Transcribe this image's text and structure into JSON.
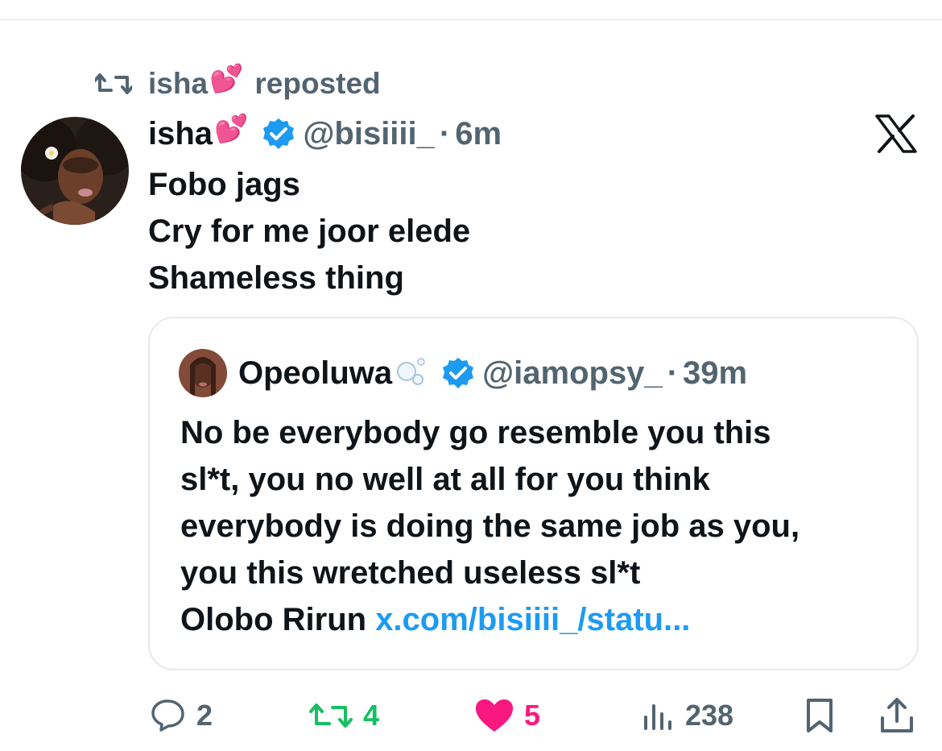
{
  "repost": {
    "name": "isha",
    "label": "reposted"
  },
  "tweet": {
    "author_name": "isha",
    "handle": "@bisiiii_",
    "separator": "·",
    "time": "6m",
    "lines": [
      "Fobo jags",
      "Cry for me joor elede",
      "Shameless thing"
    ]
  },
  "quote": {
    "author_name": "Opeoluwa",
    "handle": "@iamopsy_",
    "separator": "·",
    "time": "39m",
    "lines": [
      "No be everybody go resemble you this",
      "sl*t, you no well at all for you think",
      "everybody is doing the same job as you,",
      "you this wretched useless sl*t"
    ],
    "last_line_text": "Olobo Rirun ",
    "link": "x.com/bisiiii_/statu..."
  },
  "actions": {
    "replies": "2",
    "reposts": "4",
    "likes": "5",
    "views": "238"
  },
  "colors": {
    "secondary_text": "#536471",
    "verified_blue": "#1d9bf0",
    "repost_green": "#17bf63",
    "like_pink": "#f91880"
  },
  "icons": [
    "repost-icon",
    "heart-emoji-icon",
    "verified-badge-icon",
    "x-logo-icon",
    "bubbles-emoji-icon",
    "reply-icon",
    "like-icon",
    "views-icon",
    "bookmark-icon",
    "share-icon"
  ]
}
